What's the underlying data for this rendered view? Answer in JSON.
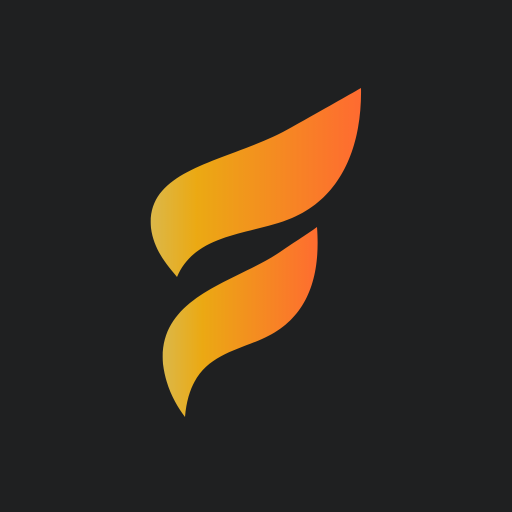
{
  "colors": {
    "background": "#1f2021",
    "gradient_start": "#dbb84a",
    "gradient_mid": "#eba913",
    "gradient_end": "#ff6a31"
  },
  "logo": {
    "icon_name": "flame-f-logo-icon"
  }
}
